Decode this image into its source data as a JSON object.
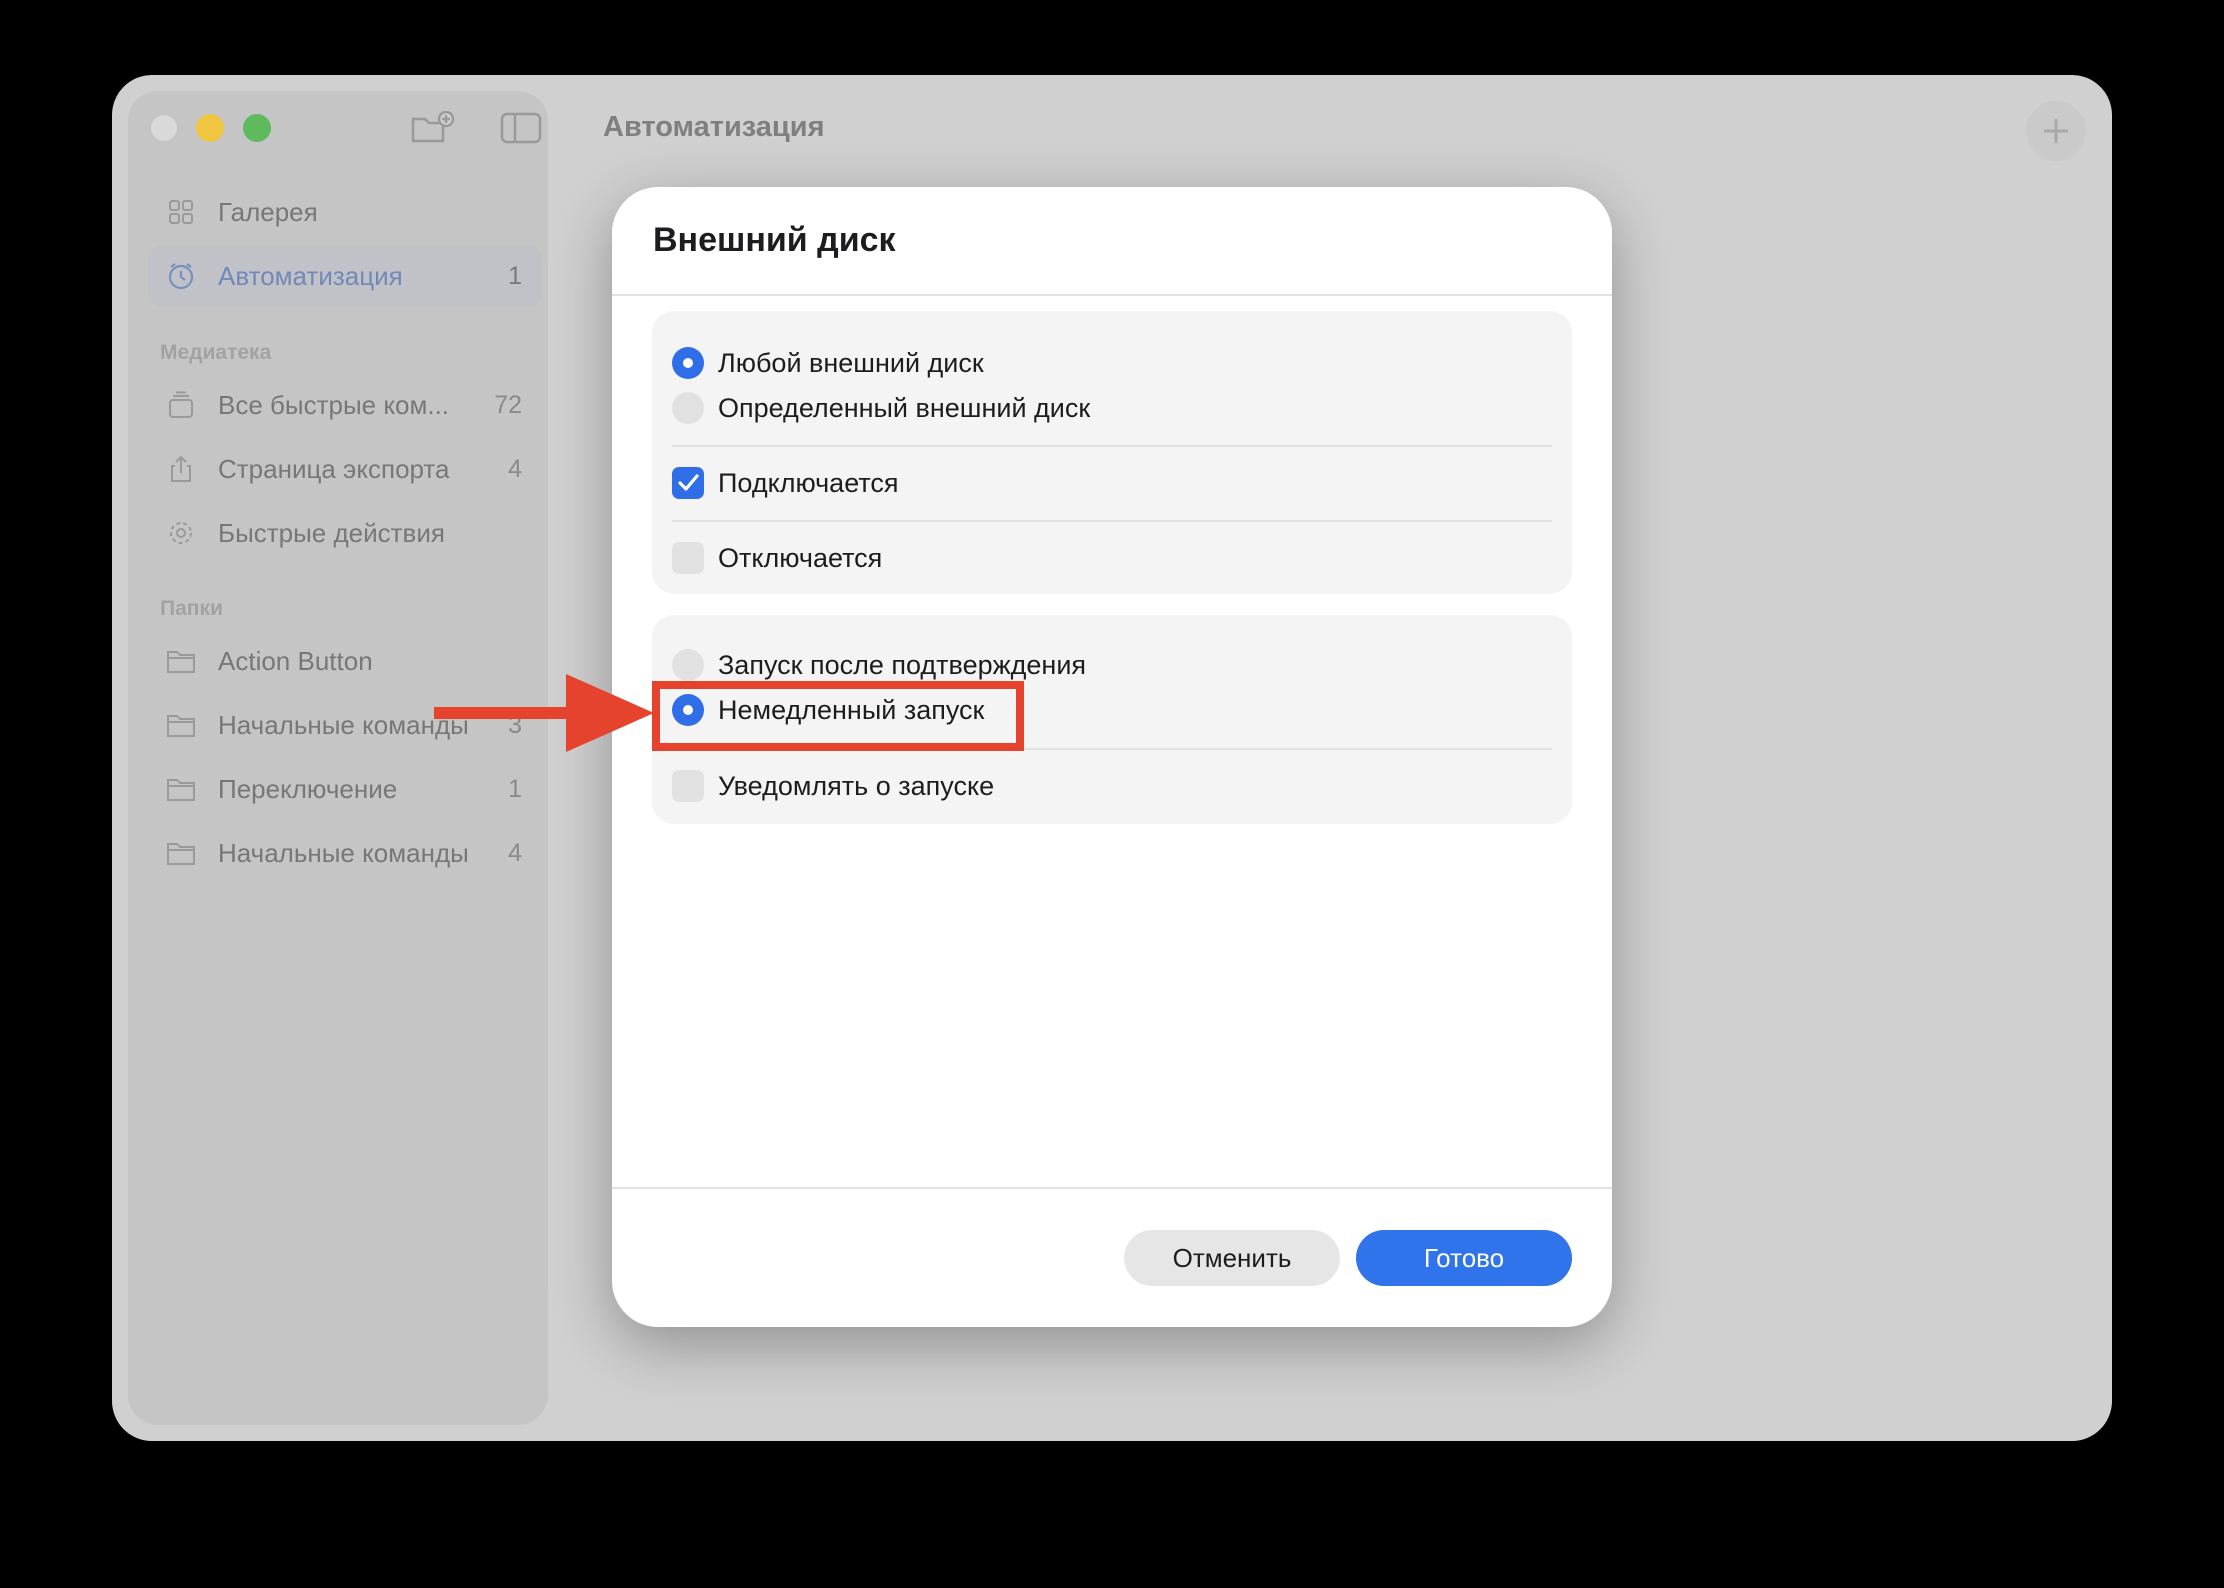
{
  "window": {
    "title": "Автоматизация",
    "toolbar": {
      "new_folder_icon": "folder-plus-icon",
      "sidebar_toggle_icon": "sidebar-icon",
      "add_icon": "plus-icon"
    }
  },
  "sidebar": {
    "top_items": [
      {
        "label": "Галерея",
        "icon": "grid-icon",
        "count": ""
      },
      {
        "label": "Автоматизация",
        "icon": "clock-icon",
        "count": "1"
      }
    ],
    "library_header": "Медиатека",
    "library_items": [
      {
        "label": "Все быстрые ком...",
        "icon": "stack-icon",
        "count": "72"
      },
      {
        "label": "Страница экспорта",
        "icon": "share-icon",
        "count": "4"
      },
      {
        "label": "Быстрые действия",
        "icon": "gear-icon",
        "count": ""
      }
    ],
    "folders_header": "Папки",
    "folder_items": [
      {
        "label": "Action Button",
        "icon": "folder-icon",
        "count": ""
      },
      {
        "label": "Начальные команды",
        "icon": "folder-icon",
        "count": "3"
      },
      {
        "label": "Переключение",
        "icon": "folder-icon",
        "count": "1"
      },
      {
        "label": "Начальные команды",
        "icon": "folder-icon",
        "count": "4"
      }
    ]
  },
  "dialog": {
    "title": "Внешний диск",
    "disk_options": [
      {
        "label": "Любой внешний диск",
        "selected": true
      },
      {
        "label": "Определенный внешний диск",
        "selected": false
      }
    ],
    "events": [
      {
        "label": "Подключается",
        "checked": true
      },
      {
        "label": "Отключается",
        "checked": false
      }
    ],
    "run_options": [
      {
        "label": "Запуск после подтверждения",
        "selected": false
      },
      {
        "label": "Немедленный запуск",
        "selected": true
      }
    ],
    "notify": {
      "label": "Уведомлять о запуске",
      "checked": false
    },
    "cancel_label": "Отменить",
    "done_label": "Готово"
  },
  "annotation": {
    "color": "#e5432d",
    "target": "Немедленный запуск"
  },
  "colors": {
    "accent": "#2f6ee6",
    "highlight": "#e5432d"
  }
}
